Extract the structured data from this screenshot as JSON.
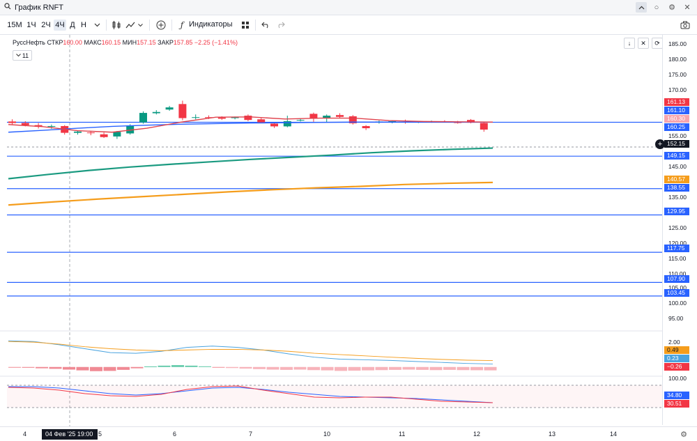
{
  "window": {
    "title": "График RNFT"
  },
  "toolbar": {
    "timeframes": [
      "15М",
      "1Ч",
      "2Ч",
      "4Ч",
      "Д",
      "Н"
    ],
    "active_timeframe": "4Ч",
    "indicators_label": "Индикаторы"
  },
  "legend": {
    "name": "РуссНефть",
    "open_label": "СТКР",
    "open_value": "160.00",
    "high_label": "МАКС",
    "high_value": "160.15",
    "low_label": "МИН",
    "low_value": "157.15",
    "close_label": "ЗАКР",
    "close_value": "157.85",
    "change": "−2.25 (−1.41%)",
    "indicator_count": "11"
  },
  "price_axis": {
    "ticks": [
      "185.00",
      "180.00",
      "175.00",
      "170.00",
      "155.00",
      "145.00",
      "135.00",
      "125.00",
      "120.00",
      "115.00",
      "110.00",
      "105.00",
      "100.00",
      "95.00",
      "2.00",
      "100.00"
    ],
    "badges": [
      {
        "value": "161.13",
        "color": "#f23645"
      },
      {
        "value": "161.10",
        "color": "#2962ff"
      },
      {
        "value": "160.30",
        "color": "#f7a5ae"
      },
      {
        "value": "160.25",
        "color": "#2962ff"
      },
      {
        "value": "152.15",
        "color": "#131722"
      },
      {
        "value": "149.15",
        "color": "#2962ff"
      },
      {
        "value": "140.57",
        "color": "#f59d1c"
      },
      {
        "value": "138.55",
        "color": "#2962ff"
      },
      {
        "value": "129.95",
        "color": "#2962ff"
      },
      {
        "value": "117.75",
        "color": "#2962ff"
      },
      {
        "value": "107.90",
        "color": "#2962ff"
      },
      {
        "value": "103.45",
        "color": "#2962ff"
      },
      {
        "value": "0.49",
        "color": "#f59d1c"
      },
      {
        "value": "0.23",
        "color": "#4aa3df"
      },
      {
        "value": "−0.26",
        "color": "#f23645"
      },
      {
        "value": "34.80",
        "color": "#2962ff"
      },
      {
        "value": "30.51",
        "color": "#f23645"
      }
    ]
  },
  "time_axis": {
    "ticks": [
      "4",
      "5",
      "6",
      "7",
      "10",
      "11",
      "12",
      "13",
      "14"
    ],
    "crosshair_label": "04 Фев '25   19:00"
  },
  "chart_data": {
    "type": "candlestick",
    "title": "",
    "ylim": [
      95,
      187
    ],
    "candles": [
      {
        "o": 160.5,
        "h": 161.2,
        "l": 159.6,
        "c": 160.0
      },
      {
        "o": 160.0,
        "h": 160.6,
        "l": 158.9,
        "c": 159.3
      },
      {
        "o": 159.3,
        "h": 160.0,
        "l": 158.2,
        "c": 158.8
      },
      {
        "o": 158.8,
        "h": 159.5,
        "l": 158.1,
        "c": 159.0
      },
      {
        "o": 159.0,
        "h": 159.3,
        "l": 156.2,
        "c": 156.8
      },
      {
        "o": 156.8,
        "h": 157.6,
        "l": 156.2,
        "c": 157.2
      },
      {
        "o": 156.9,
        "h": 157.3,
        "l": 156.0,
        "c": 156.7
      },
      {
        "o": 156.3,
        "h": 156.9,
        "l": 155.1,
        "c": 155.4
      },
      {
        "o": 155.6,
        "h": 157.4,
        "l": 154.8,
        "c": 157.1
      },
      {
        "o": 156.6,
        "h": 159.6,
        "l": 156.2,
        "c": 159.2
      },
      {
        "o": 160.2,
        "h": 163.8,
        "l": 159.8,
        "c": 163.3
      },
      {
        "o": 163.2,
        "h": 164.2,
        "l": 162.8,
        "c": 163.6
      },
      {
        "o": 164.4,
        "h": 165.6,
        "l": 164.0,
        "c": 165.1
      },
      {
        "o": 166.2,
        "h": 167.3,
        "l": 160.9,
        "c": 161.6
      },
      {
        "o": 161.7,
        "h": 162.8,
        "l": 161.2,
        "c": 161.9
      },
      {
        "o": 161.9,
        "h": 162.5,
        "l": 161.3,
        "c": 161.8
      },
      {
        "o": 161.8,
        "h": 162.2,
        "l": 161.0,
        "c": 161.4
      },
      {
        "o": 161.6,
        "h": 162.1,
        "l": 161.2,
        "c": 161.9
      },
      {
        "o": 162.4,
        "h": 162.8,
        "l": 160.6,
        "c": 161.0
      },
      {
        "o": 161.2,
        "h": 161.6,
        "l": 159.9,
        "c": 160.2
      },
      {
        "o": 159.8,
        "h": 160.2,
        "l": 158.4,
        "c": 158.9
      },
      {
        "o": 158.9,
        "h": 162.4,
        "l": 158.6,
        "c": 160.6
      },
      {
        "o": 160.9,
        "h": 161.5,
        "l": 160.5,
        "c": 161.0
      },
      {
        "o": 163.0,
        "h": 163.4,
        "l": 160.4,
        "c": 161.4
      },
      {
        "o": 161.6,
        "h": 162.8,
        "l": 160.2,
        "c": 162.4
      },
      {
        "o": 162.6,
        "h": 163.2,
        "l": 161.5,
        "c": 162.0
      },
      {
        "o": 162.2,
        "h": 162.6,
        "l": 159.5,
        "c": 159.9
      },
      {
        "o": 159.0,
        "h": 159.3,
        "l": 157.7,
        "c": 158.3
      },
      {
        "o": 160.3,
        "h": 160.8,
        "l": 159.8,
        "c": 160.5
      },
      {
        "o": 160.3,
        "h": 160.7,
        "l": 159.9,
        "c": 160.6
      },
      {
        "o": 160.4,
        "h": 161.1,
        "l": 159.8,
        "c": 160.2
      },
      {
        "o": 160.3,
        "h": 160.7,
        "l": 160.0,
        "c": 160.4
      },
      {
        "o": 160.4,
        "h": 160.8,
        "l": 160.1,
        "c": 160.5
      },
      {
        "o": 160.5,
        "h": 160.9,
        "l": 160.2,
        "c": 160.3
      },
      {
        "o": 160.4,
        "h": 160.7,
        "l": 159.8,
        "c": 160.0
      },
      {
        "o": 161.0,
        "h": 161.3,
        "l": 159.9,
        "c": 160.1
      },
      {
        "o": 160.0,
        "h": 160.15,
        "l": 157.15,
        "c": 157.85
      }
    ],
    "horizontal_levels": [
      160.25,
      149.15,
      138.55,
      129.95,
      117.75,
      107.9,
      103.45
    ],
    "dashed_level": 152.15,
    "moving_averages": [
      {
        "name": "",
        "color": "#2962ff",
        "points": [
          157.0,
          157.6,
          158.3,
          158.9,
          159.3,
          159.6,
          159.8,
          160.0,
          160.1,
          160.2,
          160.3,
          160.3,
          160.3,
          160.3,
          160.3
        ]
      },
      {
        "name": "",
        "color": "#e0434d",
        "points": [
          159.5,
          158.8,
          157.5,
          157.0,
          158.3,
          160.3,
          161.9,
          162.0,
          161.3,
          161.6,
          161.6,
          160.8,
          160.5,
          160.4,
          160.3
        ]
      },
      {
        "name": "",
        "color": "#1a9a80",
        "points": [
          141.8,
          143.2,
          144.5,
          145.6,
          146.5,
          147.3,
          148.1,
          148.8,
          149.5,
          150.3,
          150.9,
          151.4,
          151.8
        ]
      },
      {
        "name": "",
        "color": "#f59d1c",
        "points": [
          133.2,
          134.2,
          135.1,
          135.9,
          136.7,
          137.5,
          138.2,
          138.8,
          139.3,
          139.9,
          140.3,
          140.57
        ]
      }
    ],
    "macd": {
      "histogram": [
        -0.02,
        -0.06,
        -0.1,
        -0.14,
        -0.2,
        -0.26,
        -0.32,
        -0.3,
        -0.22,
        -0.1,
        0.04,
        0.1,
        0.14,
        0.1,
        0.05,
        -0.02,
        -0.08,
        -0.12,
        -0.16,
        -0.2,
        -0.22,
        -0.2,
        -0.24,
        -0.26,
        -0.3,
        -0.28,
        -0.26,
        -0.24,
        -0.22,
        -0.2,
        -0.22,
        -0.24,
        -0.22,
        -0.24,
        -0.25,
        -0.26
      ],
      "ylim": [
        -0.6,
        2.6
      ]
    },
    "rsi": {
      "ylim": [
        20,
        105
      ]
    }
  }
}
